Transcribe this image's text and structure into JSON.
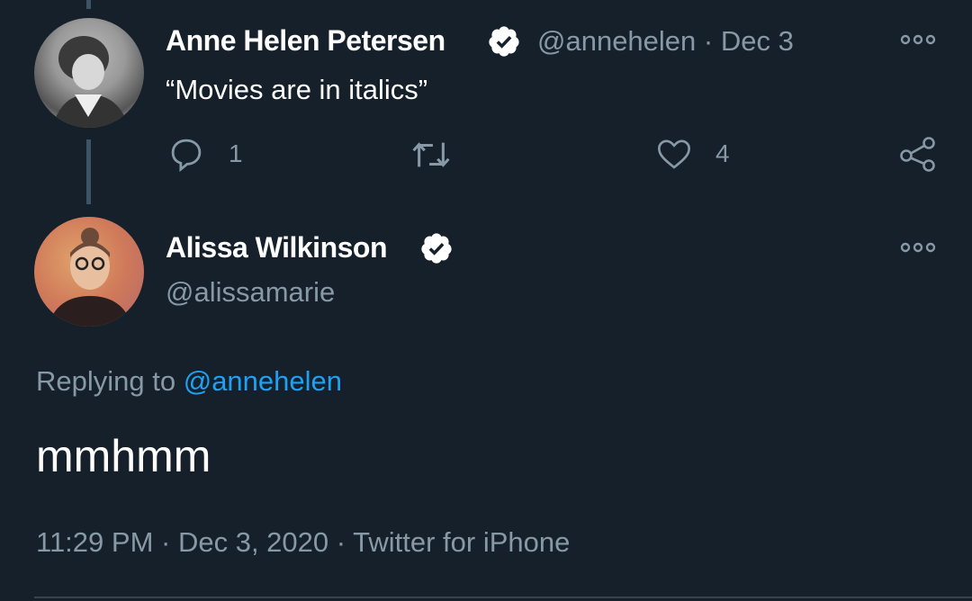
{
  "parent_tweet": {
    "author_name": "Anne Helen Petersen",
    "handle": "@annehelen",
    "separator": "·",
    "date": "Dec 3",
    "text": "“Movies are in italics”",
    "reply_count": "1",
    "like_count": "4"
  },
  "main_tweet": {
    "author_name": "Alissa Wilkinson",
    "handle": "@alissamarie",
    "replying_prefix": "Replying to",
    "replying_handle": "@annehelen",
    "text": "mmhmm",
    "time": "11:29 PM",
    "sep1": "·",
    "date": "Dec 3, 2020",
    "sep2": "·",
    "source": "Twitter for iPhone"
  },
  "colors": {
    "background": "#15202b",
    "secondary": "#8899a6",
    "link": "#1da1f2",
    "thread": "#3d5466"
  }
}
